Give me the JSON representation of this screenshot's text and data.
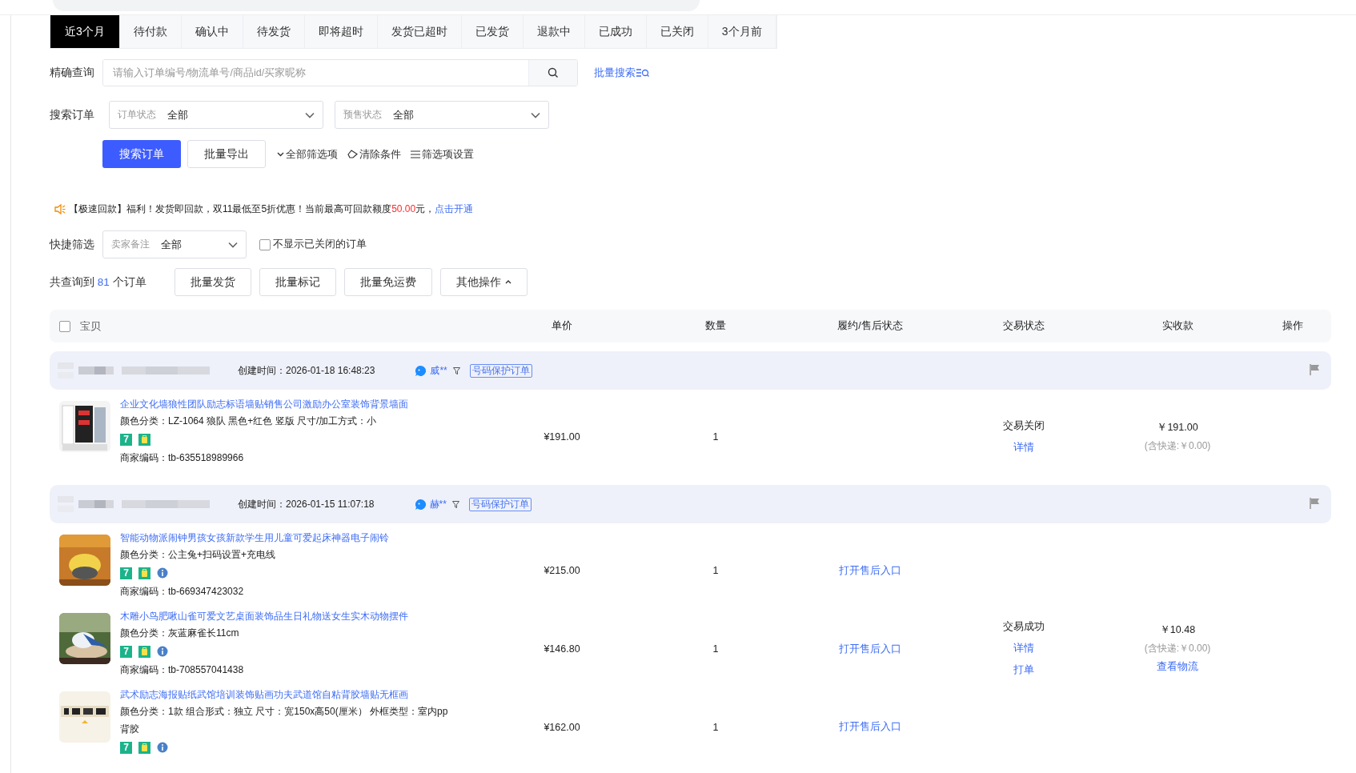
{
  "tabs": [
    {
      "label": "近3个月",
      "selected": true
    },
    {
      "label": "待付款",
      "selected": false
    },
    {
      "label": "确认中",
      "selected": false
    },
    {
      "label": "待发货",
      "selected": false
    },
    {
      "label": "即将超时",
      "selected": false
    },
    {
      "label": "发货已超时",
      "selected": false
    },
    {
      "label": "已发货",
      "selected": false
    },
    {
      "label": "退款中",
      "selected": false
    },
    {
      "label": "已成功",
      "selected": false
    },
    {
      "label": "已关闭",
      "selected": false
    },
    {
      "label": "3个月前",
      "selected": false
    }
  ],
  "search": {
    "label": "精确查询",
    "placeholder": "请输入订单编号/物流单号/商品id/买家昵称",
    "bulk_link": "批量搜索"
  },
  "order_filters": {
    "label": "搜索订单",
    "selects": [
      {
        "label": "订单状态",
        "value": "全部"
      },
      {
        "label": "预售状态",
        "value": "全部"
      }
    ]
  },
  "actions": {
    "search_button": "搜索订单",
    "export_button": "批量导出",
    "links": [
      {
        "kind": "expand",
        "label": "全部筛选项"
      },
      {
        "kind": "clear",
        "label": "清除条件"
      },
      {
        "kind": "settings",
        "label": "筛选项设置"
      }
    ]
  },
  "notice": {
    "before": "【极速回款】福利！发货即回款，双11最低至5折优惠！当前最高可回款额度",
    "amount": "50.00",
    "after": "元，",
    "link": "点击开通"
  },
  "quick_filter": {
    "label": "快捷筛选",
    "select": {
      "label": "卖家备注",
      "value": "全部"
    },
    "checkbox": {
      "label": "不显示已关闭的订单",
      "checked": false
    }
  },
  "result": {
    "prefix": "共查询到",
    "count": "81",
    "suffix": "个订单",
    "buttons": [
      "批量发货",
      "批量标记",
      "批量免运费"
    ],
    "more_button": "其他操作"
  },
  "table": {
    "select_all_checked": false,
    "columns": [
      "宝贝",
      "单价",
      "数量",
      "履约/售后状态",
      "交易状态",
      "实收款",
      "操作"
    ]
  },
  "orders": [
    {
      "created": "创建时间：2026-01-18 16:48:23",
      "buyer": "威**",
      "tag": "号码保护订单",
      "status": "交易关闭",
      "status_links": [
        "详情"
      ],
      "total": "￥191.00",
      "shipping": "(含快递:￥0.00)",
      "items": [
        {
          "title": "企业文化墙狼性团队励志标语墙贴销售公司激励办公室装饰背景墙面",
          "sku": "颜色分类：LZ-1064 狼队 黑色+红色 竖版  尺寸/加工方式：小",
          "badge": "7",
          "info": false,
          "code": "商家编码：tb-635518989966",
          "price": "¥191.00",
          "qty": "1"
        }
      ]
    },
    {
      "created": "创建时间：2026-01-15 11:07:18",
      "buyer": "赫**",
      "tag": "号码保护订单",
      "status": "交易成功",
      "status_links": [
        "详情",
        "打单"
      ],
      "total": "￥10.48",
      "shipping": "(含快递:￥0.00)",
      "total_links": [
        "查看物流"
      ],
      "items": [
        {
          "title": "智能动物派闹钟男孩女孩新款学生用儿童可爱起床神器电子闹铃",
          "sku": "颜色分类：公主兔+扫码设置+充电线",
          "badge": "7",
          "info": true,
          "code": "商家编码：tb-669347423032",
          "price": "¥215.00",
          "qty": "1",
          "aftersale": "打开售后入口"
        },
        {
          "title": "木雕小鸟肥啾山雀可爱文艺桌面装饰品生日礼物送女生实木动物摆件",
          "sku": "颜色分类：灰蓝麻雀长11cm",
          "badge": "7",
          "info": true,
          "code": "商家编码：tb-708557041438",
          "price": "¥146.80",
          "qty": "1",
          "aftersale": "打开售后入口"
        },
        {
          "title": "武术励志海报贴纸武馆培训装饰贴画功夫武道馆自粘背胶墙贴无框画",
          "sku": "颜色分类：1款  组合形式：独立  尺寸：宽150x高50(厘米）  外框类型：室内pp背胶",
          "badge": "7",
          "info": true,
          "price": "¥162.00",
          "qty": "1",
          "aftersale": "打开售后入口"
        }
      ]
    }
  ]
}
